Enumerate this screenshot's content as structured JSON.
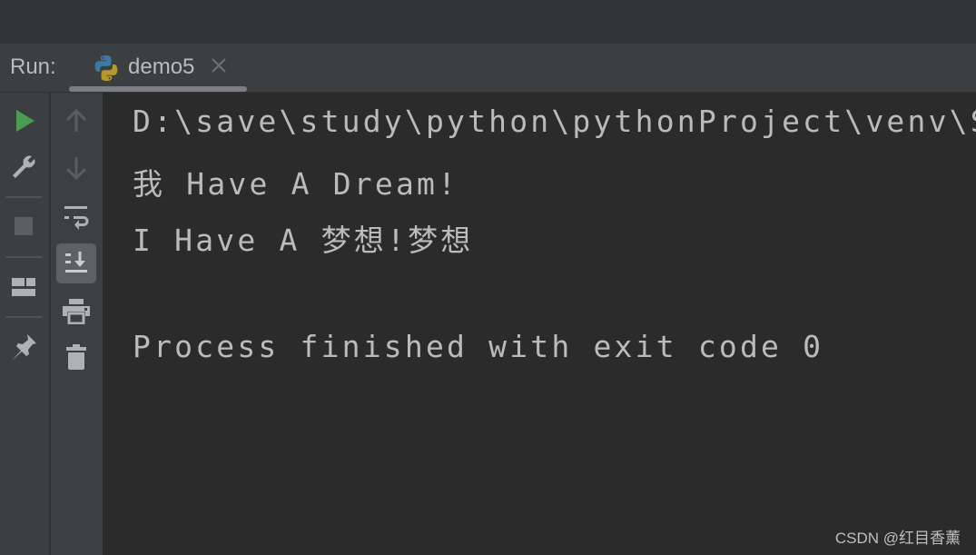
{
  "run_panel": {
    "label": "Run:",
    "tab": {
      "label": "demo5",
      "icon": "python-icon",
      "close_icon": "close-icon"
    }
  },
  "left_toolbar": {
    "items": [
      {
        "name": "rerun",
        "icon": "play-icon",
        "color": "#499c54"
      },
      {
        "name": "edit-configuration",
        "icon": "wrench-icon"
      },
      {
        "name": "stop",
        "icon": "stop-icon"
      },
      {
        "name": "restore-layout",
        "icon": "layout-icon"
      },
      {
        "name": "pin-tab",
        "icon": "pin-icon"
      }
    ]
  },
  "console_toolbar": {
    "items": [
      {
        "name": "up-stack-trace",
        "icon": "arrow-up-icon"
      },
      {
        "name": "down-stack-trace",
        "icon": "arrow-down-icon"
      },
      {
        "name": "soft-wrap",
        "icon": "soft-wrap-icon"
      },
      {
        "name": "scroll-to-end",
        "icon": "scroll-to-end-icon",
        "active": true
      },
      {
        "name": "print",
        "icon": "print-icon"
      },
      {
        "name": "clear-all",
        "icon": "trash-icon"
      }
    ]
  },
  "console": {
    "lines": [
      "D:\\save\\study\\python\\pythonProject\\venv\\Scripts\\python.exe",
      "我 Have A Dream!",
      "I Have A 梦想!梦想",
      "",
      "Process finished with exit code 0"
    ]
  },
  "watermark": "CSDN @红目香薰"
}
